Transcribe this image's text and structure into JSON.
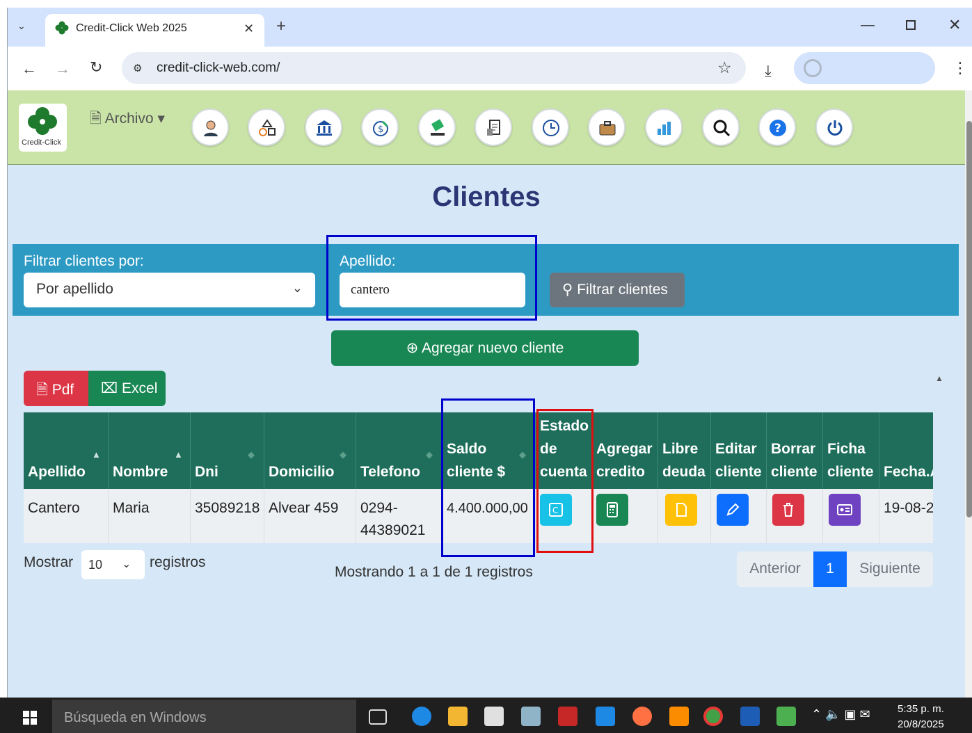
{
  "browser": {
    "tab_title": "Credit-Click Web 2025",
    "url": "credit-click-web.com/"
  },
  "app": {
    "logo_text": "Credit-Click",
    "archivo_label": "Archivo",
    "nav_icons": [
      "user-icon",
      "shapes-icon",
      "bank-icon",
      "money-icon",
      "money-hand-icon",
      "document-icon",
      "clock-icon",
      "briefcase-icon",
      "chart-icon",
      "search-icon",
      "help-icon",
      "power-icon"
    ]
  },
  "page": {
    "title": "Clientes",
    "filter": {
      "label": "Filtrar clientes por:",
      "selected": "Por apellido",
      "apellido_label": "Apellido:",
      "apellido_value": "cantero",
      "button": "Filtrar clientes"
    },
    "add_button": "Agregar nuevo cliente",
    "export": {
      "pdf": "Pdf",
      "excel": "Excel"
    },
    "table": {
      "headers": [
        {
          "lines": [
            "Apellido"
          ]
        },
        {
          "lines": [
            "Nombre"
          ]
        },
        {
          "lines": [
            "Dni"
          ]
        },
        {
          "lines": [
            "Domicilio"
          ]
        },
        {
          "lines": [
            "Telefono"
          ]
        },
        {
          "lines": [
            "Saldo",
            "cliente $"
          ]
        },
        {
          "lines": [
            "Estado",
            "de",
            "cuenta"
          ]
        },
        {
          "lines": [
            "Agregar",
            "credito"
          ]
        },
        {
          "lines": [
            "Libre",
            "deuda"
          ]
        },
        {
          "lines": [
            "Editar",
            "cliente"
          ]
        },
        {
          "lines": [
            "Borrar",
            "cliente"
          ]
        },
        {
          "lines": [
            "Ficha",
            "cliente"
          ]
        },
        {
          "lines": [
            "Fecha.A"
          ]
        }
      ],
      "row": {
        "apellido": "Cantero",
        "nombre": "Maria",
        "dni": "35089218",
        "domicilio": "Alvear 459",
        "telefono_1": "0294-",
        "telefono_2": "44389021",
        "saldo": "4.400.000,00",
        "fecha": "19-08-2"
      },
      "action_colors": {
        "estado": "#17c2e6",
        "credito": "#198754",
        "libre": "#ffc107",
        "editar": "#0d6efd",
        "borrar": "#dc3545",
        "ficha": "#6f42c1"
      }
    },
    "length": {
      "before": "Mostrar",
      "value": "10",
      "after": "registros"
    },
    "info": "Mostrando 1 a 1 de 1 registros",
    "pagination": {
      "prev": "Anterior",
      "current": "1",
      "next": "Siguiente"
    }
  },
  "taskbar": {
    "search_placeholder": "Búsqueda en Windows",
    "time": "5:35 p. m.",
    "date": "20/8/2025"
  }
}
